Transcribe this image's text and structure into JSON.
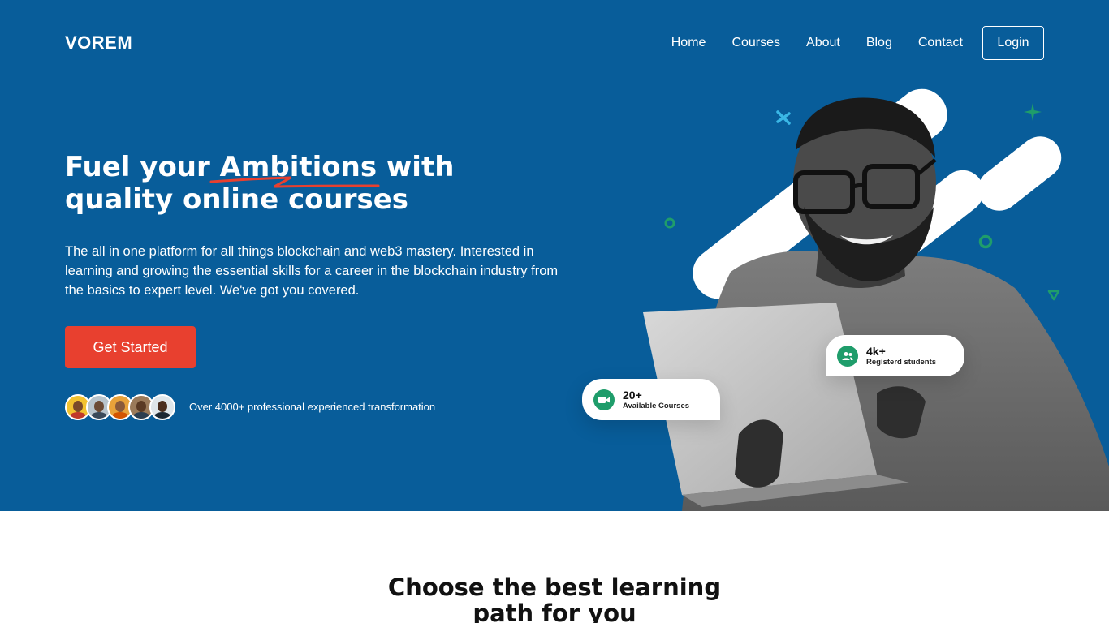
{
  "brand": {
    "name": "VOREM"
  },
  "nav": {
    "items": [
      {
        "label": "Home"
      },
      {
        "label": "Courses"
      },
      {
        "label": "About"
      },
      {
        "label": "Blog"
      },
      {
        "label": "Contact"
      }
    ],
    "login_label": "Login"
  },
  "hero": {
    "headline_line1": "Fuel your Ambitions with",
    "headline_line2": "quality online courses",
    "description": "The all in one platform for all things blockchain and web3 mastery. Interested in learning and growing the essential skills for a career in the blockchain industry from the basics to expert level. We've got you covered.",
    "cta_label": "Get Started",
    "social_proof": "Over 4000+ professional experienced transformation"
  },
  "stats": [
    {
      "value": "20+",
      "label": "Available Courses",
      "icon": "video-icon"
    },
    {
      "value": "4k+",
      "label": "Registerd students",
      "icon": "users-icon"
    }
  ],
  "section": {
    "title_line1": "Choose the best learning",
    "title_line2": "path for you"
  },
  "colors": {
    "hero_bg": "#085d9a",
    "cta": "#e8402f",
    "accent_green": "#1f9d6b",
    "squiggle": "#e8402f"
  }
}
